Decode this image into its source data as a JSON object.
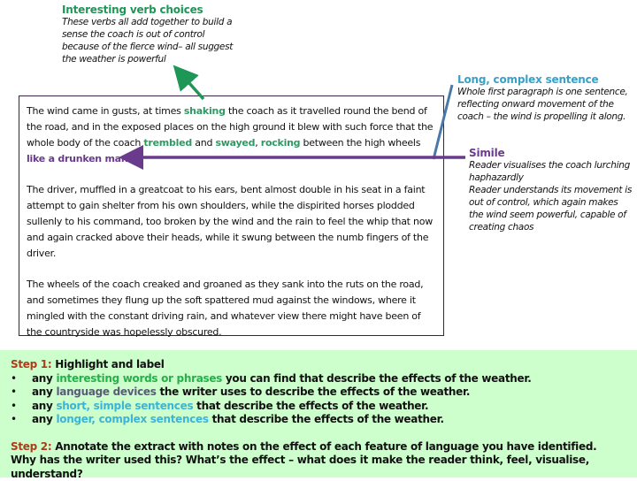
{
  "annotations": {
    "verbs": {
      "title": "Interesting verb choices",
      "body": "These verbs all add together to build a sense the coach is out of control because of the fierce wind– all suggest the weather is powerful"
    },
    "long_sentence": {
      "title": "Long, complex sentence",
      "body": "Whole first paragraph is one sentence, reflecting onward movement of the coach – the wind is propelling it along."
    },
    "simile": {
      "title": "Simile",
      "body_1": "Reader visualises the coach lurching haphazardly",
      "body_2": "Reader understands its movement is out of control, which again makes the wind seem powerful, capable of creating chaos"
    }
  },
  "passage": {
    "p1": {
      "t1": "The wind came in gusts, at times ",
      "v1": "shaking",
      "t2": " the coach as it travelled round the bend of the road, and in the exposed places on the high ground it blew with such force that the whole body of the coach ",
      "v2": "trembled",
      "t3": " and ",
      "v3": "swayed",
      "t4": ", ",
      "v4": "rocking",
      "t5": " between the high wheels ",
      "simile": "like a drunken man",
      "t6": "."
    },
    "p2": "The driver, muffled in a greatcoat to his ears, bent almost double in his seat in a faint attempt to gain shelter from his own shoulders, while the dispirited horses plodded sullenly to his command, too broken by the wind and the rain to feel the whip that now and again cracked above their heads, while it swung between the numb fingers of the driver.",
    "p3": "The wheels of the coach creaked and groaned as they sank into the ruts on the road, and sometimes they flung up the soft spattered mud against the windows, where it mingled with the constant driving rain, and whatever view there might have been of the countryside was hopelessly obscured."
  },
  "tasks": {
    "step1": {
      "label": "Step 1:",
      "title": " Highlight and label",
      "bullet_glyph": "•",
      "items": [
        {
          "pre": "any ",
          "highlight": "interesting words or phrases",
          "post": " you can find that describe the effects of the weather."
        },
        {
          "pre": "any ",
          "highlight": "language devices",
          "post": " the writer uses to describe the effects of the weather."
        },
        {
          "pre": "any ",
          "highlight": "short, simple sentences",
          "post": " that describe the effects of the weather."
        },
        {
          "pre": "any ",
          "highlight": "longer, complex sentences",
          "post": " that describe the effects of the weather."
        }
      ]
    },
    "step2": {
      "label": "Step 2:",
      "line1": " Annotate the extract with notes on the effect of each feature of language you have identified.",
      "line2": "Why has the writer used this? What’s the effect – what does it make the reader think, feel, visualise, understand?"
    }
  },
  "colors": {
    "verb_green": "#2e9a62",
    "long_blue": "#3aa0c8",
    "simile_purple": "#6a3a8c",
    "step_red": "#b03a1a",
    "task_bg": "#ccffcc",
    "arrow_green": "#1e9656",
    "line_blue": "#4a78a8",
    "arrow_purple": "#6a3a8c"
  }
}
